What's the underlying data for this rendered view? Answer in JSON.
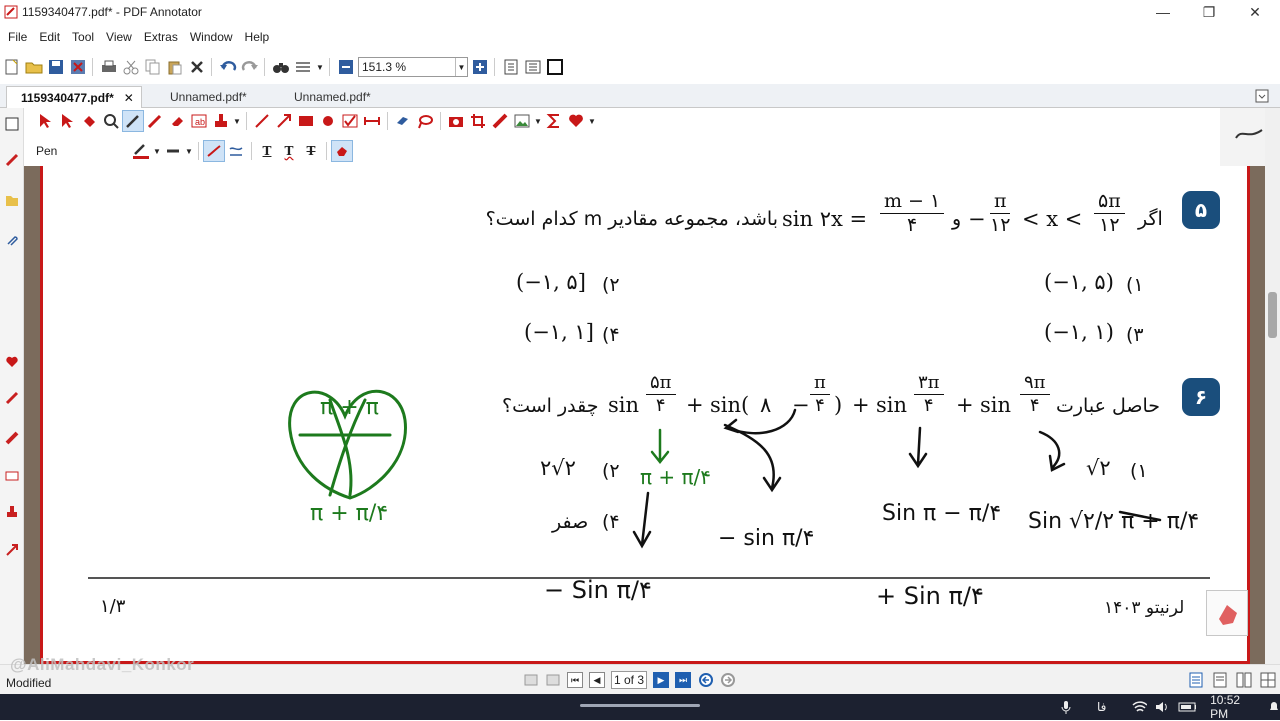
{
  "window": {
    "title": "1159340477.pdf* - PDF Annotator",
    "minimize": "—",
    "maximize": "❐",
    "close": "✕"
  },
  "menu": [
    "File",
    "Edit",
    "Tool",
    "View",
    "Extras",
    "Window",
    "Help"
  ],
  "toolbar": {
    "zoom_value": "151.3 %"
  },
  "tabs": [
    {
      "label": "1159340477.pdf*",
      "close": "✕"
    },
    {
      "label": "Unnamed.pdf*"
    },
    {
      "label": "Unnamed.pdf*"
    }
  ],
  "annotbar": {
    "tool_label": "Pen",
    "text_tools": [
      "T",
      "T",
      "T"
    ]
  },
  "doc": {
    "q5": {
      "number": "۵",
      "text_if": "اگر",
      "text_rest": "باشد، مجموعه مقادیر m کدام است؟",
      "and": "و",
      "frac_a_num": "۵π",
      "frac_a_den": "۱۲",
      "frac_b_num": "π",
      "frac_b_den": "۱۲",
      "frac_c_num": "m − ۱",
      "frac_c_den": "۴",
      "lt_x": "< x <",
      "minus": "−",
      "sin2x": "sin ۲x =",
      "options": [
        {
          "num": "۱)",
          "value": "(−۱, ۵)"
        },
        {
          "num": "۲)",
          "value": "(−۱, ۵]"
        },
        {
          "num": "۳)",
          "value": "(−۱, ۱)"
        },
        {
          "num": "۴)",
          "value": "(−۱, ۱]"
        }
      ]
    },
    "q6": {
      "number": "۶",
      "text_prefix": "حاصل عبارت",
      "text_suffix": "چقدر است؟",
      "sin": "sin",
      "plus": "+",
      "sin_paren": "sin(",
      "eight": "۸",
      "minus": "−",
      "close_paren": ")",
      "t1_num": "۵π",
      "t1_den": "۴",
      "t2_num": "π",
      "t2_den": "۴",
      "t3_num": "۳π",
      "t3_den": "۴",
      "t4_num": "۹π",
      "t4_den": "۴",
      "options": [
        {
          "num": "۱)",
          "value": "√۲"
        },
        {
          "num": "۲)",
          "value": "۲√۲"
        },
        {
          "num": "۴)",
          "value": "صفر"
        }
      ]
    },
    "footer": {
      "page": "۱/۳",
      "brand": "لرنیتو ۱۴۰۳"
    }
  },
  "handwriting": {
    "green_top": "π + π",
    "green_side": "π + π/۴",
    "green_arrow_label": "π + π/۴",
    "h1": "Sin π − π/۴",
    "h2": "− sin π/۴",
    "h3": "− Sin π/۴",
    "h4": "+ Sin π/۴",
    "h5": "Sin √۲/۲ π + π/۴"
  },
  "status": {
    "text": "Modified",
    "watermark": "@AliMahdavi_Konkor",
    "page_value": "1 of 3"
  },
  "taskbar": {
    "lang": "فا",
    "time": "10:52 PM"
  },
  "colors": {
    "accent": "#1a4e7c",
    "page_border": "#c81818",
    "ink_black": "#111111",
    "ink_green": "#1d7a1d"
  }
}
